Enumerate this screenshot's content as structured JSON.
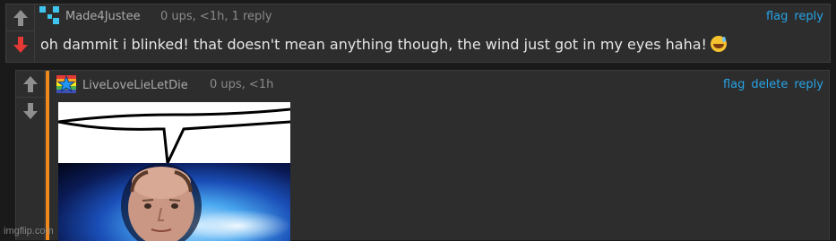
{
  "comments": [
    {
      "username": "Made4Justee",
      "meta": "0 ups, <1h, 1 reply",
      "actions": [
        "flag",
        "reply"
      ],
      "text": "oh dammit i blinked! that doesn't mean anything though, the wind just got in my eyes haha!",
      "emoji": "grinning-face-with-sweat",
      "vote_state": "downvoted"
    },
    {
      "username": "LiveLoveLieLetDie",
      "meta": "0 ups, <1h",
      "actions": [
        "flag",
        "delete",
        "reply"
      ],
      "image": "speech-bubble-meme-with-man-in-space"
    }
  ],
  "colors": {
    "link": "#27a4e6",
    "accent": "#f08a1c",
    "downvote": "#e53935",
    "background": "#2d2d2d"
  },
  "watermark": "imgflip.com"
}
